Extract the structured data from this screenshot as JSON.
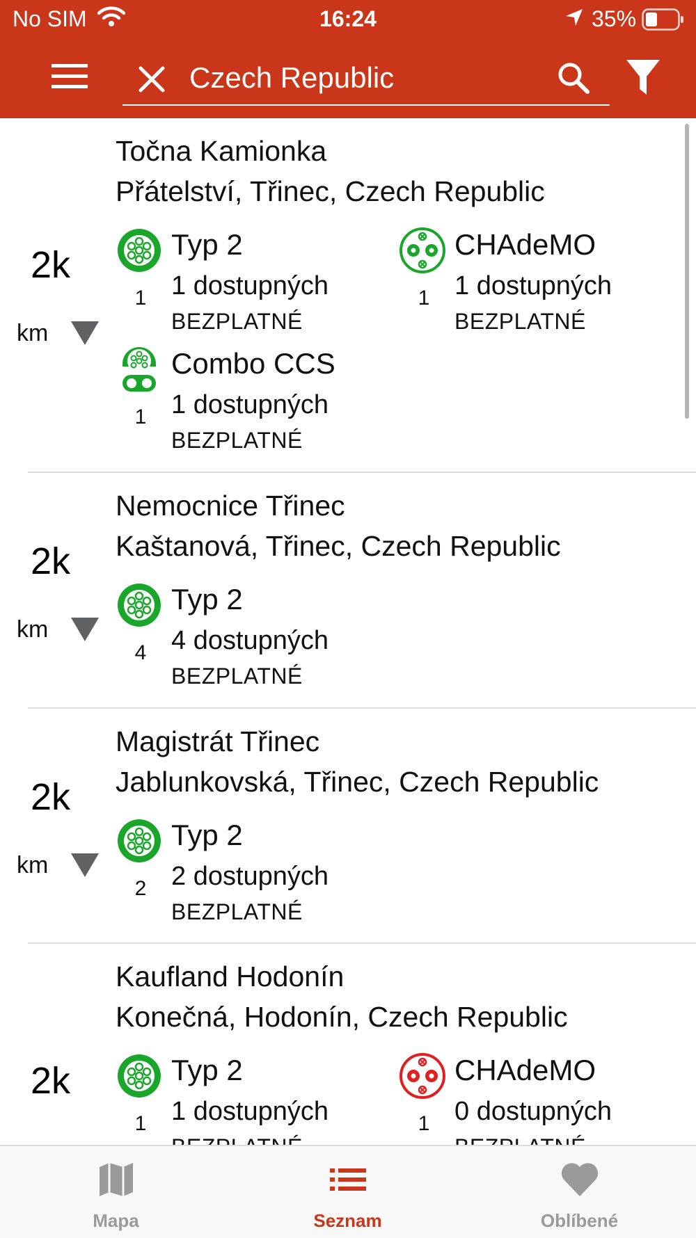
{
  "status_bar": {
    "carrier": "No SIM",
    "time": "16:24",
    "battery": "35%"
  },
  "header": {
    "search_value": "Czech Republic",
    "menu_icon": "hamburger-icon",
    "clear_icon": "close-icon",
    "search_icon": "search-icon",
    "filter_icon": "filter-icon"
  },
  "colors": {
    "header_bg": "#c9361a",
    "available": "#1aa62a",
    "unavailable": "#e02020",
    "tab_active": "#c9361a",
    "tab_inactive": "#9a9a9a"
  },
  "stations": [
    {
      "name": "Točna Kamionka",
      "address": "Přátelství, Třinec, Czech Republic",
      "distance": "2k",
      "unit": "km",
      "connectors": [
        {
          "type": "Typ 2",
          "count": "1",
          "available": "1 dostupných",
          "price": "BEZPLATNÉ",
          "icon": "type2-plug-icon",
          "status": "available"
        },
        {
          "type": "CHAdeMO",
          "count": "1",
          "available": "1 dostupných",
          "price": "BEZPLATNÉ",
          "icon": "chademo-plug-icon",
          "status": "available"
        },
        {
          "type": "Combo CCS",
          "count": "1",
          "available": "1 dostupných",
          "price": "BEZPLATNÉ",
          "icon": "ccs-plug-icon",
          "status": "available"
        }
      ]
    },
    {
      "name": "Nemocnice Třinec",
      "address": "Kaštanová, Třinec, Czech Republic",
      "distance": "2k",
      "unit": "km",
      "connectors": [
        {
          "type": "Typ 2",
          "count": "4",
          "available": "4 dostupných",
          "price": "BEZPLATNÉ",
          "icon": "type2-plug-icon",
          "status": "available"
        }
      ]
    },
    {
      "name": "Magistrát Třinec",
      "address": "Jablunkovská, Třinec, Czech Republic",
      "distance": "2k",
      "unit": "km",
      "connectors": [
        {
          "type": "Typ 2",
          "count": "2",
          "available": "2 dostupných",
          "price": "BEZPLATNÉ",
          "icon": "type2-plug-icon",
          "status": "available"
        }
      ]
    },
    {
      "name": "Kaufland Hodonín",
      "address": "Konečná, Hodonín, Czech Republic",
      "distance": "2k",
      "unit": "km",
      "connectors": [
        {
          "type": "Typ 2",
          "count": "1",
          "available": "1 dostupných",
          "price": "BEZPLATNÉ",
          "icon": "type2-plug-icon",
          "status": "available"
        },
        {
          "type": "CHAdeMO",
          "count": "1",
          "available": "0 dostupných",
          "price": "BEZPLATNÉ",
          "icon": "chademo-plug-icon",
          "status": "unavailable"
        }
      ]
    }
  ],
  "tabs": [
    {
      "label": "Mapa",
      "icon": "map-icon",
      "active": false
    },
    {
      "label": "Seznam",
      "icon": "list-icon",
      "active": true
    },
    {
      "label": "Oblíbené",
      "icon": "heart-icon",
      "active": false
    }
  ]
}
